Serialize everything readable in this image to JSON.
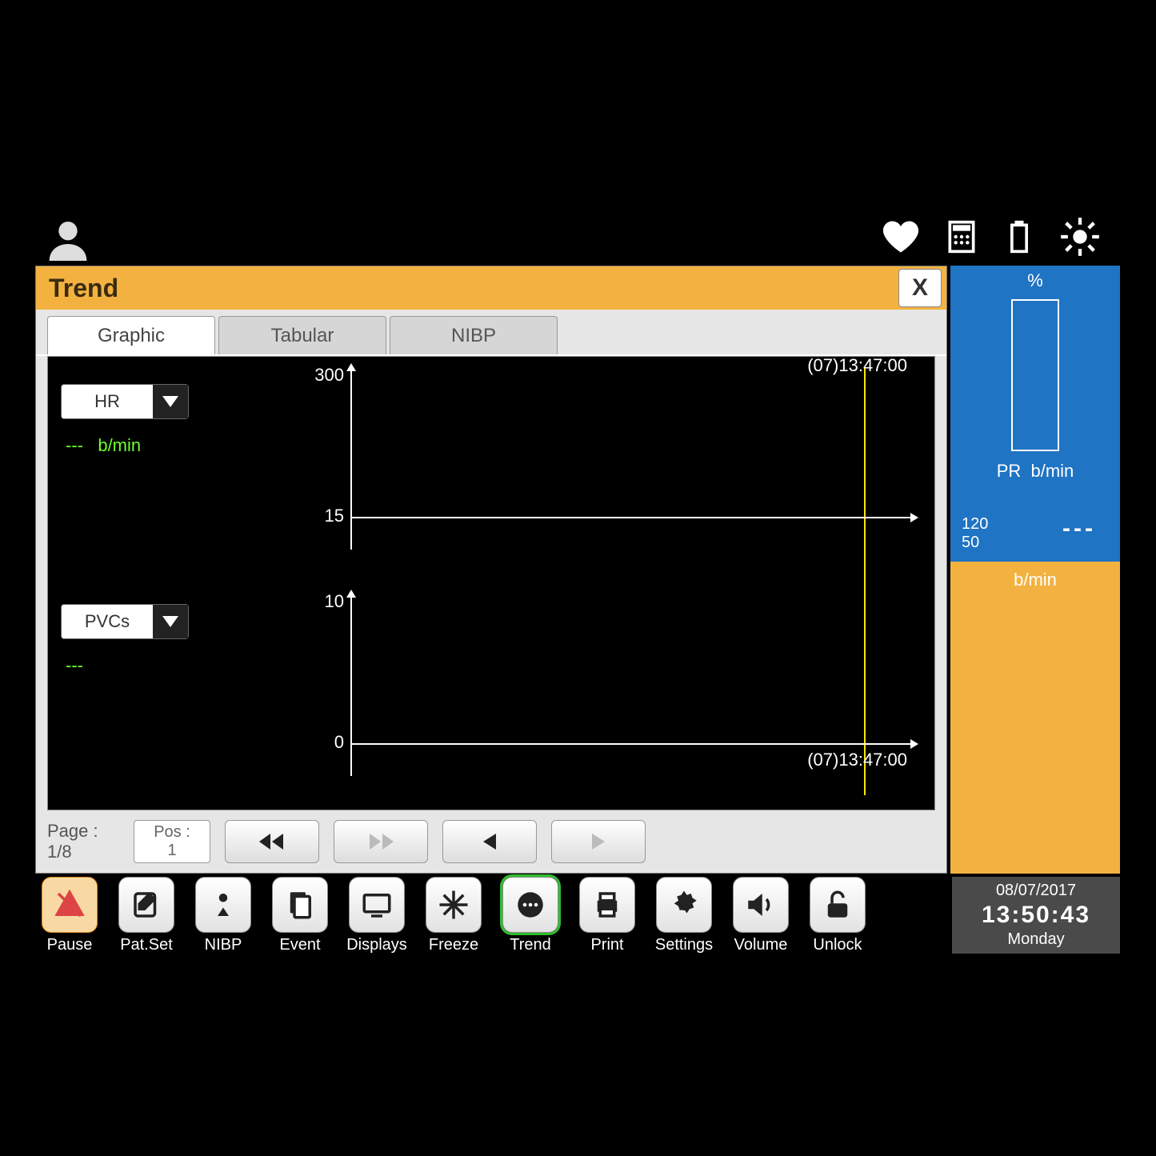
{
  "panel": {
    "title": "Trend",
    "close": "X",
    "tabs": [
      "Graphic",
      "Tabular",
      "NIBP"
    ],
    "active_tab": 0,
    "page_label": "Page :",
    "page_value": "1/8",
    "pos_label": "Pos :",
    "pos_value": "1"
  },
  "graphs": [
    {
      "param": "HR",
      "value": "---",
      "unit": "b/min",
      "y_max": "300",
      "y_min": "15",
      "time": "(07)13:47:00"
    },
    {
      "param": "PVCs",
      "value": "---",
      "unit": "",
      "y_max": "10",
      "y_min": "0",
      "time": "(07)13:47:00"
    }
  ],
  "spo2": {
    "pct_label": "%",
    "pr_label": "PR",
    "pr_unit": "b/min",
    "limit_hi": "120",
    "limit_lo": "50",
    "dashes": "---"
  },
  "lower_box": {
    "unit": "b/min"
  },
  "toolbar": [
    {
      "id": "pause",
      "label": "Pause"
    },
    {
      "id": "patset",
      "label": "Pat.Set"
    },
    {
      "id": "nibp",
      "label": "NIBP"
    },
    {
      "id": "event",
      "label": "Event"
    },
    {
      "id": "displays",
      "label": "Displays"
    },
    {
      "id": "freeze",
      "label": "Freeze"
    },
    {
      "id": "trend",
      "label": "Trend"
    },
    {
      "id": "print",
      "label": "Print"
    },
    {
      "id": "settings",
      "label": "Settings"
    },
    {
      "id": "volume",
      "label": "Volume"
    },
    {
      "id": "unlock",
      "label": "Unlock"
    }
  ],
  "clock": {
    "date": "08/07/2017",
    "time": "13:50:43",
    "day": "Monday"
  },
  "chart_data": [
    {
      "type": "line",
      "title": "HR",
      "ylabel": "b/min",
      "ylim": [
        15,
        300
      ],
      "x_cursor": "(07)13:47:00",
      "series": [
        {
          "name": "HR",
          "values": []
        }
      ]
    },
    {
      "type": "line",
      "title": "PVCs",
      "ylabel": "",
      "ylim": [
        0,
        10
      ],
      "x_cursor": "(07)13:47:00",
      "series": [
        {
          "name": "PVCs",
          "values": []
        }
      ]
    }
  ]
}
